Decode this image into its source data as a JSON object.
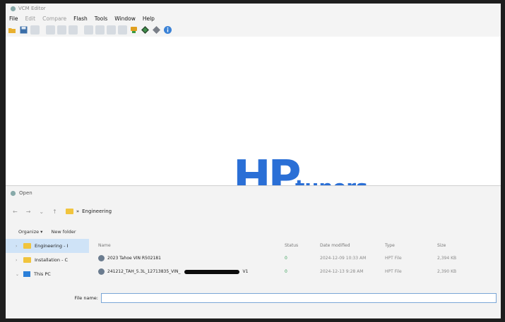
{
  "vcm": {
    "title": "VCM Editor",
    "menu": [
      "File",
      "Edit",
      "Compare",
      "Flash",
      "Tools",
      "Window",
      "Help"
    ],
    "toolbar_icons": [
      "open-icon",
      "save-icon",
      "disabled-icon",
      "disabled-icon",
      "disabled-icon",
      "disabled-icon",
      "disabled-icon",
      "disabled-icon",
      "disabled-icon",
      "disabled-icon",
      "vehicle-icon",
      "diamond-green-icon",
      "diamond-gray-icon",
      "info-icon"
    ]
  },
  "logo": {
    "hp": "HP",
    "tuners": "tuners"
  },
  "dialog": {
    "title": "Open",
    "breadcrumb": "Engineering",
    "organize": "Organize ▾",
    "new_folder": "New folder",
    "sidebar": [
      {
        "label": "Engineering - I"
      },
      {
        "label": "Installation - C"
      },
      {
        "label": "This PC"
      }
    ],
    "columns": {
      "name": "Name",
      "status": "Status",
      "date": "Date modified",
      "type": "Type",
      "size": "Size"
    },
    "files": [
      {
        "name": "2023 Tahoe VIN R502181",
        "name_suffix": "",
        "status": "0",
        "date": "2024-12-09 10:33 AM",
        "type": "HPT File",
        "size": "2,394 KB"
      },
      {
        "name": "241212_TAH_5.3L_12713835_VIN_",
        "name_suffix": "V1",
        "status": "0",
        "date": "2024-12-13 9:28 AM",
        "type": "HPT File",
        "size": "2,390 KB"
      }
    ],
    "file_name_label": "File name:",
    "file_name_value": ""
  },
  "colors": {
    "brand": "#2a6fd6",
    "selection": "#cfe3f7",
    "status_ok": "#3aa05a"
  }
}
